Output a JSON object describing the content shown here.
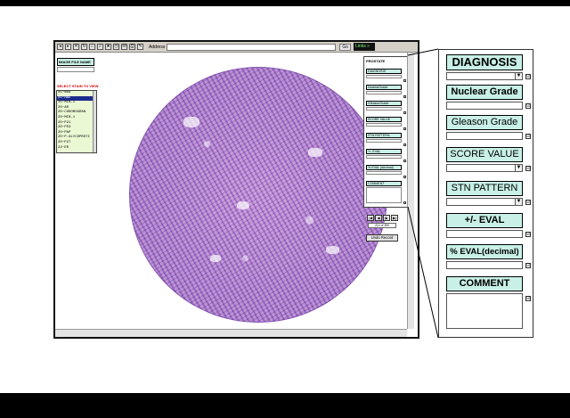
{
  "browser": {
    "address_label": "Address",
    "go_label": "Go",
    "toolbar_text": "Links »"
  },
  "form": {
    "image_file_label": "IMAGE FILE NAME",
    "stain_prompt": "SELECT STAIN TO VIEW",
    "stain_options": [
      "01~mod",
      "02~H&E",
      "15~MIB-1",
      "20~AR",
      "20~CHROMOGRAN",
      "20~MIB-1",
      "20~P21",
      "20~P53",
      "20~PAP",
      "20~P-GLYCOPROTI",
      "20~P27",
      "22~ER"
    ]
  },
  "mini_panel": {
    "title": "PROSTATE",
    "fields": [
      "DIAGNOSIS",
      "NuclearGrade",
      "GleasonGrade",
      "SCORE VALUE",
      "STN PATTERN",
      "+/- EVAL",
      "% EVAL (decimal)",
      "COMMENT"
    ]
  },
  "navigation": {
    "first": "|◀",
    "prev": "◀",
    "next": "▶",
    "last": "▶|",
    "record_counter": "214 of 390",
    "undo_label": "Undo Record"
  },
  "enlarged_panel": {
    "diagnosis": "DIAGNOSIS",
    "nuclear_grade": "Nuclear Grade",
    "gleason_grade": "Gleason Grade",
    "score_value": "SCORE VALUE",
    "stn_pattern": "STN PATTERN",
    "eval_pm": "+/- EVAL",
    "eval_pct": "% EVAL(decimal)",
    "comment": "COMMENT",
    "checkbox_glyph": "☑",
    "dropdown_glyph": "▼"
  }
}
